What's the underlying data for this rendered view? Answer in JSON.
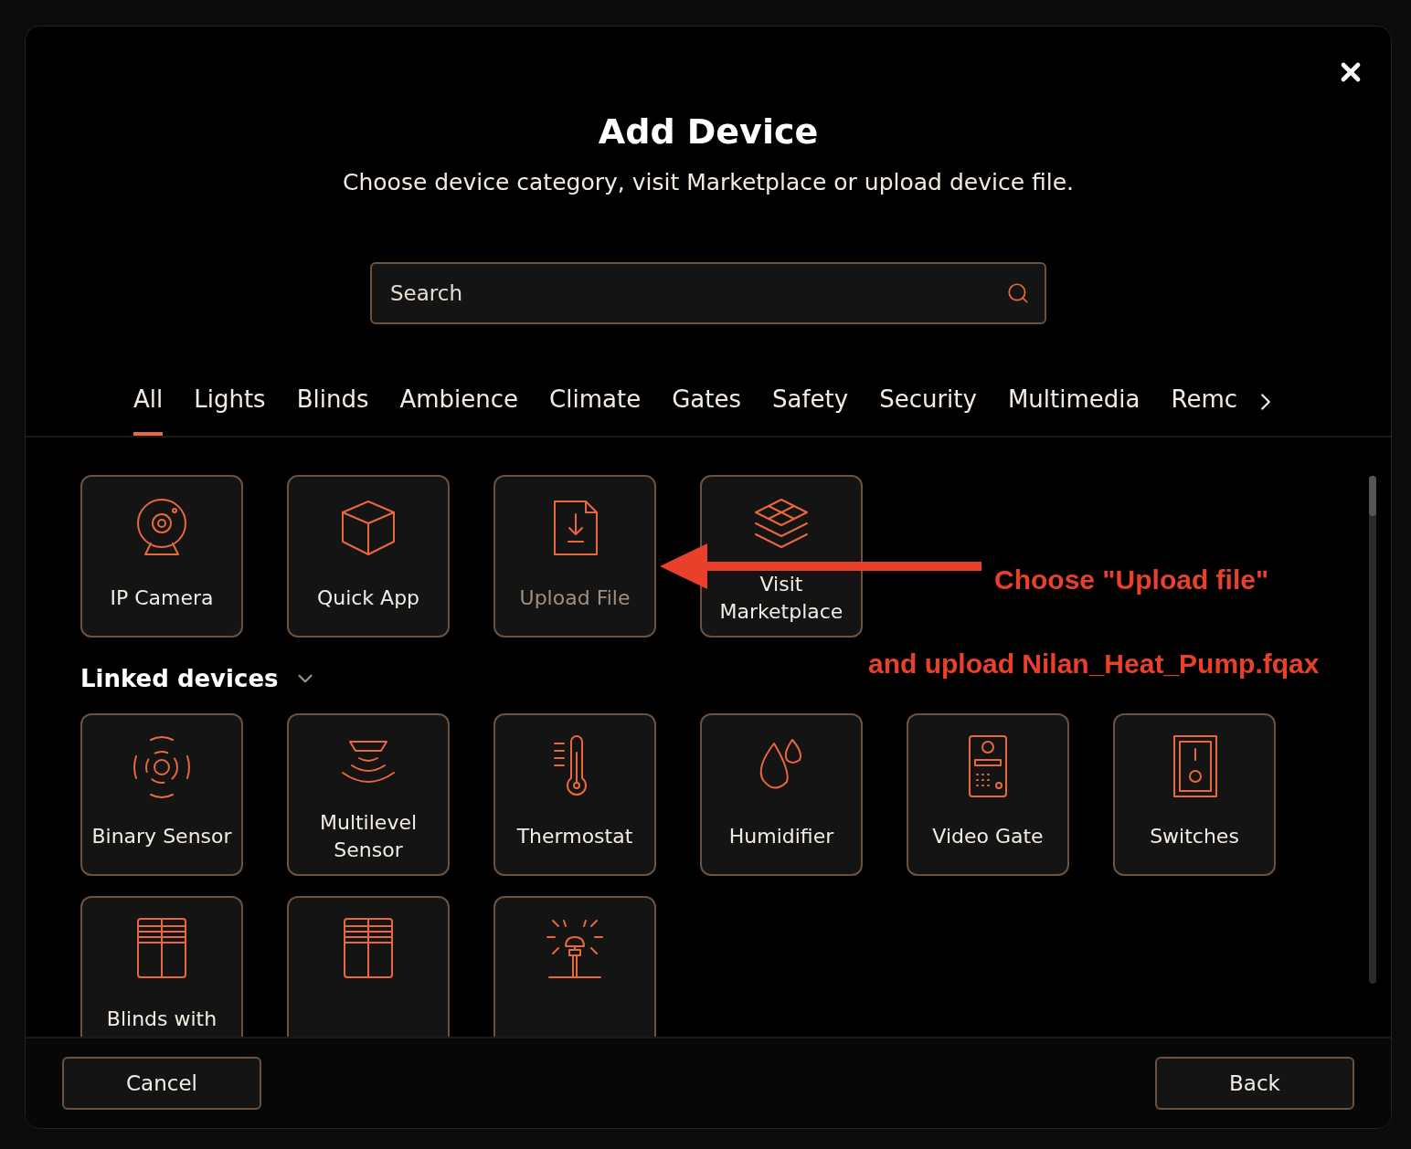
{
  "dialog": {
    "title": "Add Device",
    "subtitle": "Choose device category, visit Marketplace or upload device file."
  },
  "search": {
    "placeholder": "Search"
  },
  "tabs": [
    {
      "label": "All",
      "selected": true
    },
    {
      "label": "Lights",
      "selected": false
    },
    {
      "label": "Blinds",
      "selected": false
    },
    {
      "label": "Ambience",
      "selected": false
    },
    {
      "label": "Climate",
      "selected": false
    },
    {
      "label": "Gates",
      "selected": false
    },
    {
      "label": "Safety",
      "selected": false
    },
    {
      "label": "Security",
      "selected": false
    },
    {
      "label": "Multimedia",
      "selected": false
    },
    {
      "label": "Remc",
      "selected": false
    }
  ],
  "top_tiles": [
    {
      "label": "IP Camera",
      "disabled": false
    },
    {
      "label": "Quick App",
      "disabled": false
    },
    {
      "label": "Upload File",
      "disabled": true
    },
    {
      "label": "Visit Marketplace",
      "disabled": false
    }
  ],
  "linked_devices": {
    "title": "Linked devices",
    "expanded": true,
    "tiles": [
      {
        "kind": "tile",
        "label": "Binary Sensor"
      },
      {
        "kind": "tile",
        "label": "Multilevel Sensor"
      },
      {
        "kind": "tile",
        "label": "Thermostat"
      },
      {
        "kind": "tile",
        "label": "Humidifier"
      },
      {
        "kind": "tile",
        "label": "Video Gate"
      },
      {
        "kind": "tile",
        "label": "Switches"
      },
      {
        "kind": "tile",
        "label": "Blinds with"
      },
      {
        "kind": "tile"
      },
      {
        "kind": "tile"
      }
    ]
  },
  "annotation": {
    "lines": [
      "Choose \"Upload file\"",
      "and upload Nilan_Heat_Pump.fqax"
    ]
  },
  "footer": {
    "cancel": "Cancel",
    "back": "Back"
  }
}
